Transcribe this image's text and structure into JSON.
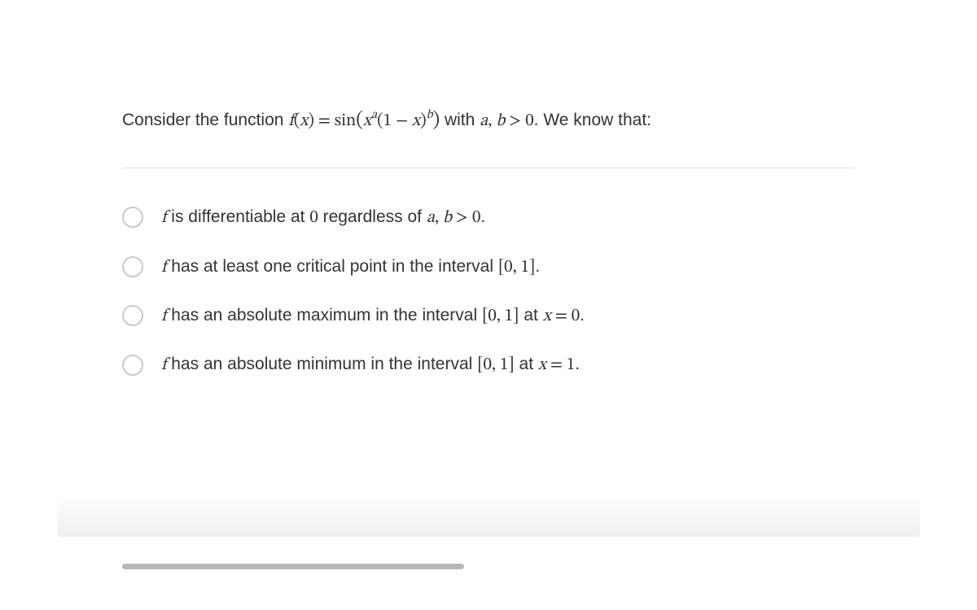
{
  "question": {
    "prefix": "Consider the function ",
    "fn_lhs_f": "f",
    "fn_lhs_of": "(",
    "fn_lhs_x": "x",
    "fn_lhs_close": ") = sin",
    "fn_open": "(",
    "fn_x": "x",
    "fn_exp_a": "a",
    "fn_mid": "(1 − ",
    "fn_x2": "x",
    "fn_close1": ")",
    "fn_exp_b": "b",
    "fn_close2": ")",
    "with": " with ",
    "cond_a": "a",
    "cond_comma": ", ",
    "cond_b": "b",
    "cond_rest": " > 0",
    "suffix": ". We know that:"
  },
  "options": [
    {
      "f": "f",
      "t1": " is differentiable at ",
      "num0": "0",
      "t2": " regardless of ",
      "a": "a",
      "comma": ", ",
      "b": "b",
      "gt": " > 0",
      "end": "."
    },
    {
      "f": "f",
      "t1": " has at least one critical point in the interval ",
      "int": "[0, 1]",
      "end": "."
    },
    {
      "f": "f",
      "t1": " has an absolute maximum in the interval ",
      "int": "[0, 1]",
      "at": " at ",
      "x": "x",
      "eq": " = 0",
      "end": "."
    },
    {
      "f": "f",
      "t1": " has an absolute minimum in the interval ",
      "int": "[0, 1]",
      "at": " at ",
      "x": "x",
      "eq": " = 1",
      "end": "."
    }
  ]
}
